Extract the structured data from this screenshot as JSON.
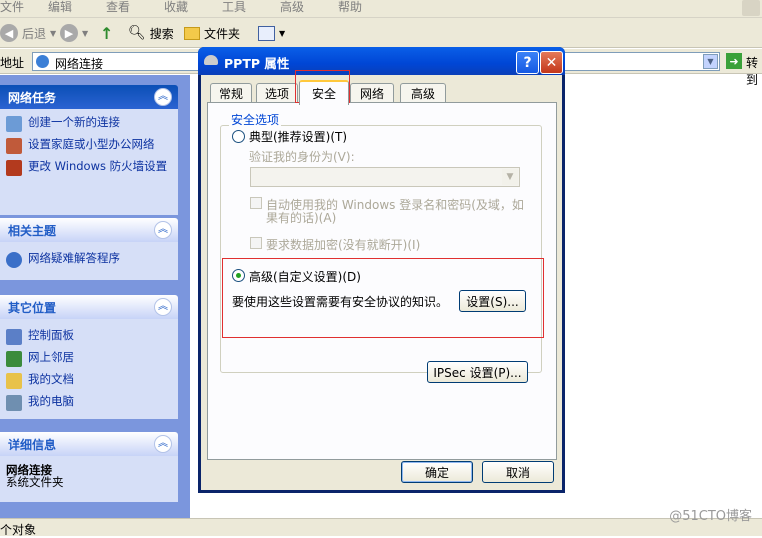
{
  "menubar": {
    "items": [
      "文件",
      "编辑",
      "查看",
      "收藏",
      "工具",
      "高级",
      "帮助"
    ]
  },
  "toolbar": {
    "back": "后退",
    "search": "搜索",
    "folders": "文件夹"
  },
  "address": {
    "label": "地址",
    "value": "网络连接",
    "go": "转到"
  },
  "sidebar": {
    "network_tasks": {
      "title": "网络任务",
      "items": [
        "创建一个新的连接",
        "设置家庭或小型办公网络",
        "更改 Windows 防火墙设置"
      ]
    },
    "related": {
      "title": "相关主题",
      "items": [
        "网络疑难解答程序"
      ]
    },
    "other": {
      "title": "其它位置",
      "items": [
        "控制面板",
        "网上邻居",
        "我的文档",
        "我的电脑"
      ]
    },
    "details": {
      "title": "详细信息",
      "name": "网络连接",
      "type": "系统文件夹"
    }
  },
  "status": {
    "text": "个对象"
  },
  "dialog": {
    "title": "PPTP 属性",
    "tabs": [
      "常规",
      "选项",
      "安全",
      "网络",
      "高级"
    ],
    "active_tab": "安全",
    "group_title": "安全选项",
    "typical_label": "典型(推荐设置)(T)",
    "verify_label": "验证我的身份为(V):",
    "auto_windows_line1": "自动使用我的 Windows 登录名和密码(及域，如",
    "auto_windows_line2": "果有的话)(A)",
    "require_encryption": "要求数据加密(没有就断开)(I)",
    "advanced_label": "高级(自定义设置)(D)",
    "advanced_selected": true,
    "advanced_desc": "要使用这些设置需要有安全协议的知识。",
    "settings_button": "设置(S)...",
    "ipsec_button": "IPSec 设置(P)...",
    "ok_button": "确定",
    "cancel_button": "取消"
  },
  "watermark": "@51CTO博客"
}
